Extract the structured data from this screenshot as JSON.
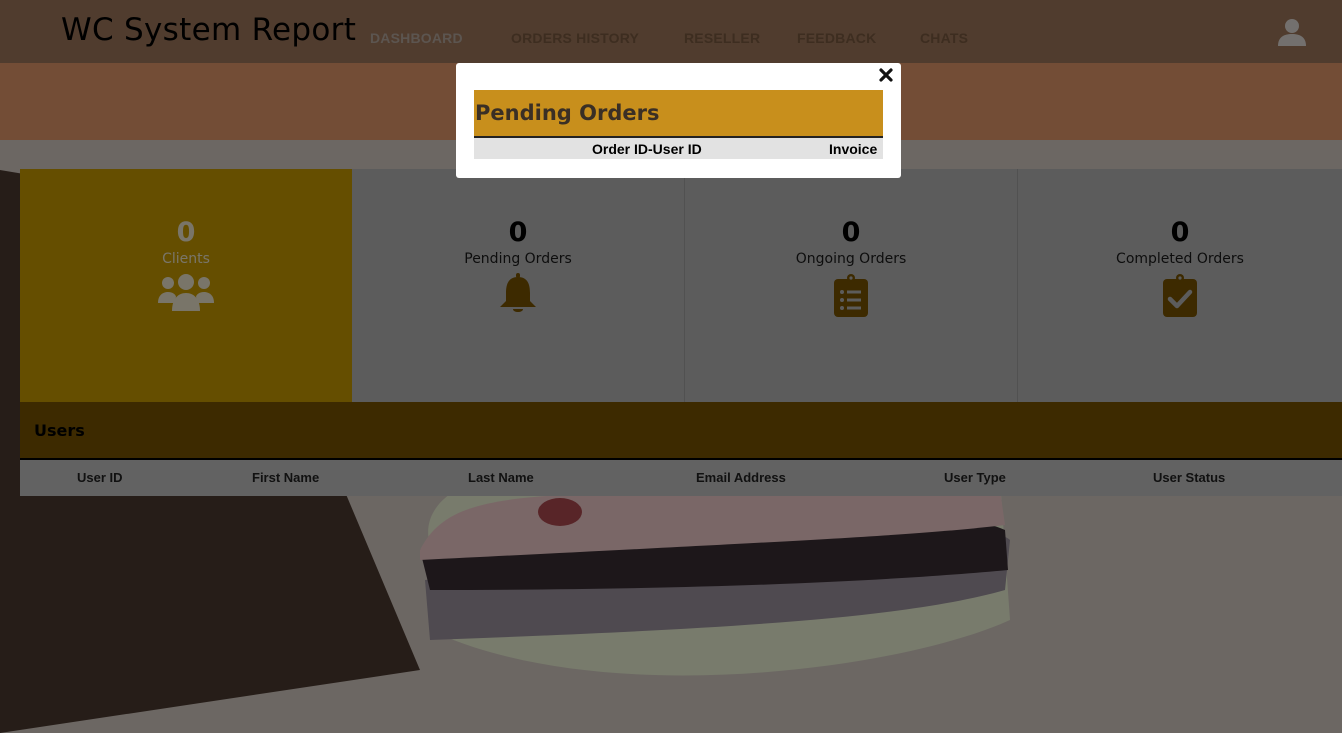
{
  "header": {
    "brand": "WC System Report",
    "nav": [
      "DASHBOARD",
      "ORDERS HISTORY",
      "RESELLER",
      "FEEDBACK",
      "CHATS"
    ],
    "active_index": 0,
    "user_icon": "user-icon"
  },
  "stats": [
    {
      "value": "0",
      "label": "Clients",
      "icon": "users-icon"
    },
    {
      "value": "0",
      "label": "Pending Orders",
      "icon": "bell-icon"
    },
    {
      "value": "0",
      "label": "Ongoing Orders",
      "icon": "clipboard-list-icon"
    },
    {
      "value": "0",
      "label": "Completed Orders",
      "icon": "clipboard-check-icon"
    }
  ],
  "users": {
    "title": "Users",
    "columns": [
      "User ID",
      "First Name",
      "Last Name",
      "Email Address",
      "User Type",
      "User Status"
    ]
  },
  "modal": {
    "title": "Pending Orders",
    "columns": [
      "Order ID-User ID",
      "Invoice"
    ],
    "close_icon": "close-icon"
  },
  "colors": {
    "accent": "#c88f1c",
    "clients_tile": "#ca9d00",
    "users_bar": "#7a5500",
    "header": "#a0785c",
    "band": "#e79a6c"
  }
}
